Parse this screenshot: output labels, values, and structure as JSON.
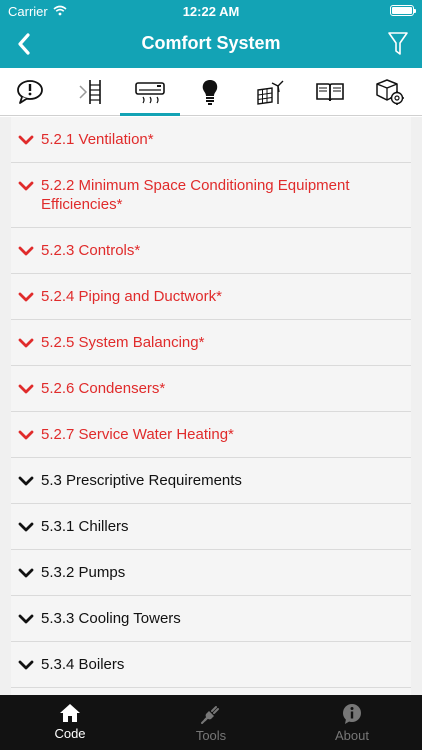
{
  "status": {
    "carrier": "Carrier",
    "time": "12:22 AM"
  },
  "nav": {
    "title": "Comfort System"
  },
  "top_tabs": [
    {
      "icon": "speech-alert-icon",
      "active": false
    },
    {
      "icon": "ladder-door-icon",
      "active": false
    },
    {
      "icon": "air-conditioner-icon",
      "active": true
    },
    {
      "icon": "light-bulb-icon",
      "active": false
    },
    {
      "icon": "solar-wind-icon",
      "active": false
    },
    {
      "icon": "book-icon",
      "active": false
    },
    {
      "icon": "box-gear-icon",
      "active": false
    }
  ],
  "colors": {
    "header": "#13a3b5",
    "accent_red": "#e02b2b",
    "tabbar_bg": "#121212"
  },
  "list": {
    "items": [
      {
        "label": "5.2.1 Ventilation*",
        "style": "red"
      },
      {
        "label": "5.2.2 Minimum Space Conditioning Equipment Efficiencies*",
        "style": "red"
      },
      {
        "label": "5.2.3 Controls*",
        "style": "red"
      },
      {
        "label": "5.2.4 Piping and Ductwork*",
        "style": "red"
      },
      {
        "label": "5.2.5 System Balancing*",
        "style": "red"
      },
      {
        "label": "5.2.6 Condensers*",
        "style": "red"
      },
      {
        "label": "5.2.7 Service Water Heating*",
        "style": "red"
      },
      {
        "label": "5.3 Prescriptive Requirements",
        "style": "black"
      },
      {
        "label": "5.3.1 Chillers",
        "style": "black"
      },
      {
        "label": "5.3.2 Pumps",
        "style": "black"
      },
      {
        "label": "5.3.3 Cooling Towers",
        "style": "black"
      },
      {
        "label": "5.3.4 Boilers",
        "style": "black"
      },
      {
        "label": "",
        "style": "black"
      }
    ]
  },
  "bottom_tabs": [
    {
      "label": "Code",
      "icon": "home-icon",
      "active": true
    },
    {
      "label": "Tools",
      "icon": "plug-icon",
      "active": false
    },
    {
      "label": "About",
      "icon": "info-icon",
      "active": false
    }
  ]
}
